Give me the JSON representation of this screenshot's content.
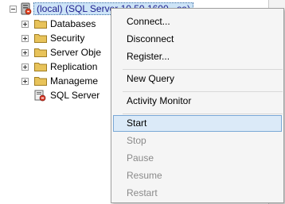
{
  "object_explorer": {
    "root": {
      "label": "(local) (SQL Server 10.50.1600 - sa)"
    },
    "nodes": [
      {
        "label": "Databases",
        "icon": "folder-icon"
      },
      {
        "label": "Security",
        "icon": "folder-icon"
      },
      {
        "label": "Server Obje",
        "icon": "folder-icon"
      },
      {
        "label": "Replication",
        "icon": "folder-icon"
      },
      {
        "label": "Manageme",
        "icon": "folder-icon"
      },
      {
        "label": "SQL Server",
        "icon": "sql-agent-icon"
      }
    ]
  },
  "context_menu": {
    "items": [
      {
        "label": "Connect...",
        "enabled": true
      },
      {
        "label": "Disconnect",
        "enabled": true
      },
      {
        "label": "Register...",
        "enabled": true
      },
      {
        "label": "New Query",
        "enabled": true
      },
      {
        "label": "Activity Monitor",
        "enabled": true
      },
      {
        "label": "Start",
        "enabled": true,
        "highlighted": true
      },
      {
        "label": "Stop",
        "enabled": false
      },
      {
        "label": "Pause",
        "enabled": false
      },
      {
        "label": "Resume",
        "enabled": false
      },
      {
        "label": "Restart",
        "enabled": false
      }
    ]
  },
  "colors": {
    "selection": "#cde4f7",
    "menu_background": "#f5f5f5",
    "menu_hover": "#dbeaf8",
    "disabled_text": "#8a8a8a",
    "folder": "#e8c35a"
  }
}
